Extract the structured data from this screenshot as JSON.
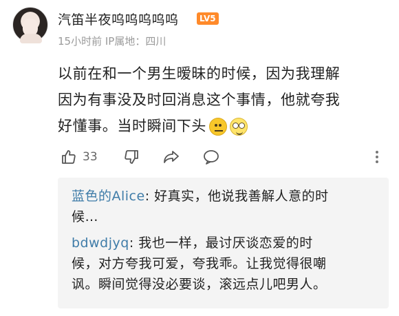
{
  "comment": {
    "username": "汽笛半夜呜呜呜呜呜",
    "level_badge": "LV5",
    "meta": "15小时前 IP属地：四川",
    "content_lines": [
      "以前在和一个男生暧昧的时候，因为我理解",
      "因为有事没及时回消息这个事情，他就夸我",
      "好懂事。当时瞬间下头"
    ],
    "emojis": [
      "neutral-face-emoji",
      "dizzy-face-emoji"
    ],
    "like_count": "33"
  },
  "replies": [
    {
      "name": "蓝色的Alice",
      "lines": [
        ": 好真实，他说我善解人意的时",
        "候…"
      ]
    },
    {
      "name": "bdwdjyq",
      "lines": [
        ": 我也一样，最讨厌谈恋爱的时",
        "候，对方夸我可爱，夸我乖。让我觉得很嘲",
        "讽。瞬间觉得没必要谈，滚远点儿吧男人。"
      ]
    }
  ]
}
